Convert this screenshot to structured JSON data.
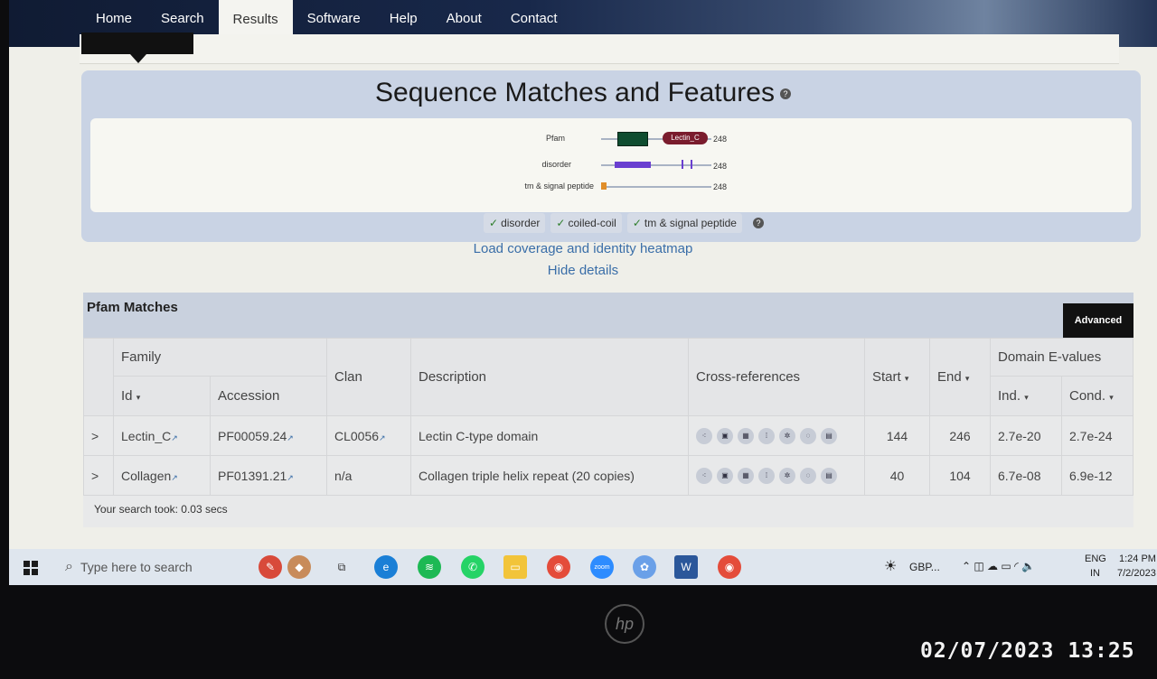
{
  "nav": {
    "items": [
      "Home",
      "Search",
      "Results",
      "Software",
      "Help",
      "About",
      "Contact"
    ],
    "active": "Results"
  },
  "features": {
    "title": "Sequence Matches and Features",
    "tracks": [
      {
        "label": "Pfam",
        "length": "248"
      },
      {
        "label": "disorder",
        "length": "248"
      },
      {
        "label": "tm & signal peptide",
        "length": "248"
      }
    ],
    "pfam_domain_label": "Lectin_C",
    "toggles": [
      "disorder",
      "coiled-coil",
      "tm & signal peptide"
    ],
    "heatmap_link": "Load coverage and identity heatmap",
    "hide_link": "Hide details"
  },
  "pfam": {
    "title": "Pfam Matches",
    "advanced_button": "Advanced",
    "headers": {
      "family": "Family",
      "id": "Id",
      "accession": "Accession",
      "clan": "Clan",
      "description": "Description",
      "xref": "Cross-references",
      "start": "Start",
      "end": "End",
      "evalues": "Domain E-values",
      "ind": "Ind.",
      "cond": "Cond."
    },
    "rows": [
      {
        "id": "Lectin_C",
        "accession": "PF00059.24",
        "clan": "CL0056",
        "description": "Lectin C-type domain",
        "start": "144",
        "end": "246",
        "ind": "2.7e-20",
        "cond": "2.7e-24"
      },
      {
        "id": "Collagen",
        "accession": "PF01391.21",
        "clan": "n/a",
        "description": "Collagen triple helix repeat (20 copies)",
        "start": "40",
        "end": "104",
        "ind": "6.7e-08",
        "cond": "6.9e-12"
      }
    ],
    "search_time": "Your search took: 0.03 secs"
  },
  "taskbar": {
    "search_placeholder": "Type here to search",
    "weather": "GBP...",
    "lang": "ENG",
    "region": "IN",
    "time": "1:24 PM",
    "date": "7/2/2023"
  },
  "photo_timestamp": "02/07/2023 13:25",
  "colors": {
    "nav": "#16264a",
    "pfam_domain": "#0f4d30",
    "lectin_domain": "#7a1c2d",
    "disorder": "#6a3fd0",
    "signal": "#e08e2a",
    "link": "#3a6ea8"
  }
}
